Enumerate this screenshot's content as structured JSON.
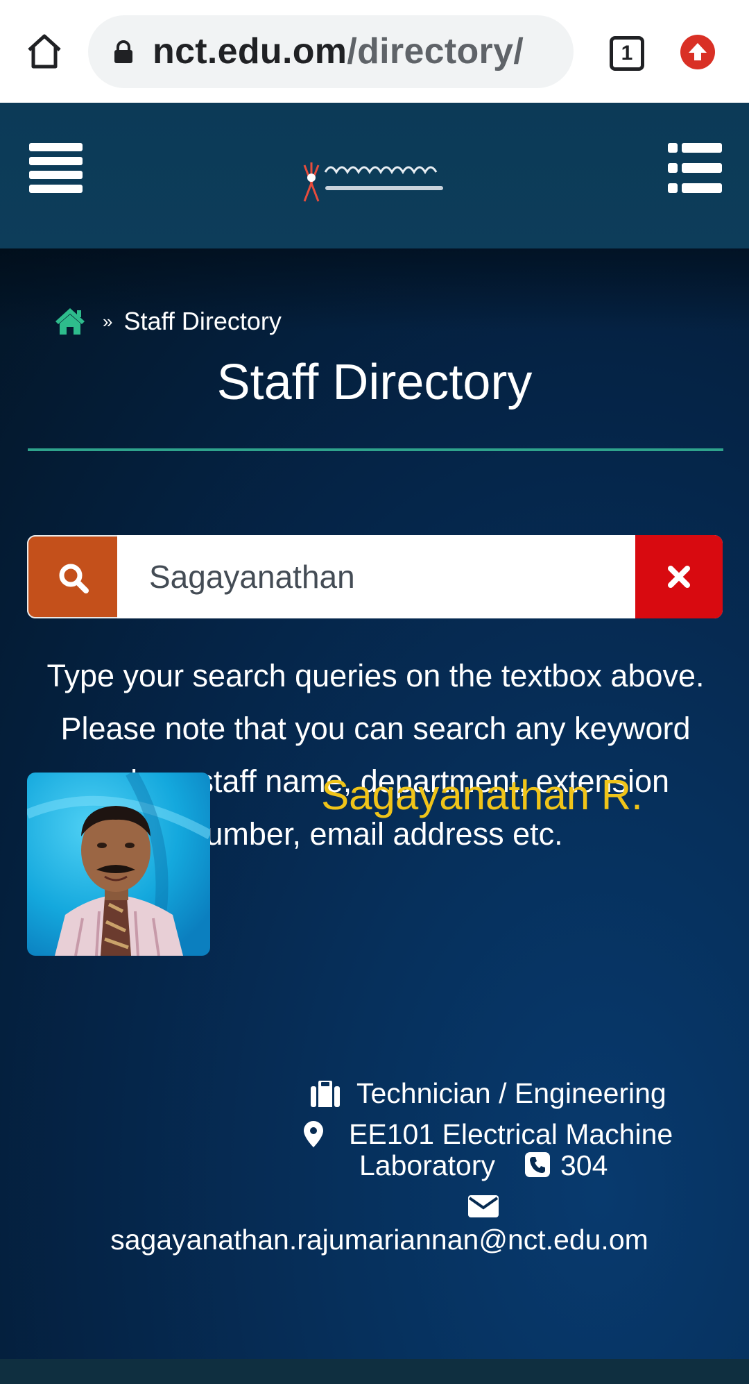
{
  "browser": {
    "url_domain": "nct.edu.om",
    "url_path": "/directory/",
    "tab_count": "1"
  },
  "header": {
    "logo_alt": "University of Technology and Applied Sciences - Nizwa"
  },
  "breadcrumb": {
    "separator": "»",
    "current": "Staff Directory"
  },
  "page": {
    "title": "Staff Directory"
  },
  "search": {
    "value": "Sagayanathan",
    "help_text": "Type your search queries on the textbox above. Please note that you can search any keyword such as staff name, department, extension number, email address etc."
  },
  "result": {
    "name": "Sagayanathan R.",
    "position": "Technician / Engineering",
    "location_line1": "EE101 Electrical Machine",
    "location_line2": "Laboratory",
    "extension": "304",
    "email": "sagayanathan.rajumariannan@nct.edu.om"
  },
  "colors": {
    "accent_teal": "#2fa38c",
    "search_button": "#c4501b",
    "clear_button": "#d80a10",
    "name_gold": "#f0c419"
  },
  "icons": [
    "home-icon",
    "lock-icon",
    "tab-switcher-icon",
    "update-icon",
    "hamburger-menu-icon",
    "list-menu-icon",
    "breadcrumb-home-icon",
    "search-icon",
    "close-icon",
    "briefcase-icon",
    "map-marker-icon",
    "phone-icon",
    "envelope-icon"
  ]
}
